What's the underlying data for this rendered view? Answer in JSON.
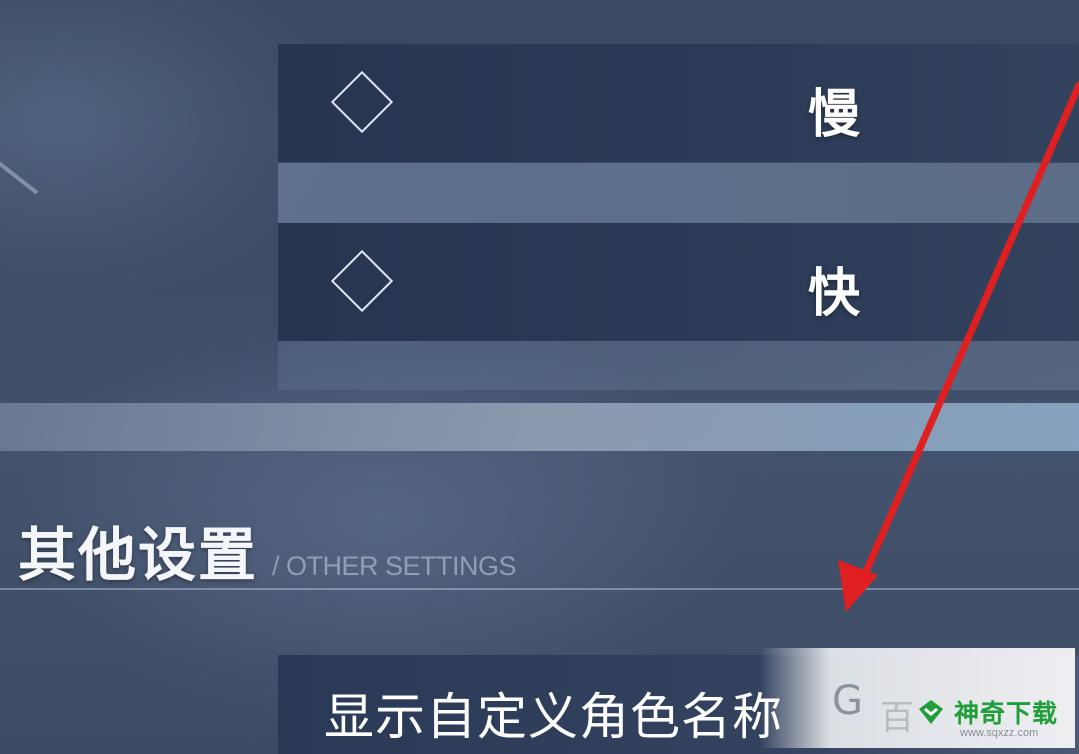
{
  "speed_options": {
    "slow": {
      "label": "慢",
      "icon": "diamond-outline"
    },
    "fast": {
      "label": "快",
      "icon": "diamond-outline"
    }
  },
  "other_settings": {
    "title": "其他设置",
    "subtitle": "/ OTHER SETTINGS",
    "items": [
      {
        "label": "显示自定义角色名称"
      }
    ]
  },
  "annotation": {
    "type": "arrow",
    "color": "#e02020"
  },
  "watermark": {
    "logo_glyph": "G",
    "faded_text": "百",
    "brand_name": "神奇下载",
    "brand_url": "www.sqxzz.com",
    "brand_color": "#1f9e3a"
  },
  "colors": {
    "panel": "#2b3a56",
    "text": "#ffffff",
    "arrow": "#e02020"
  }
}
